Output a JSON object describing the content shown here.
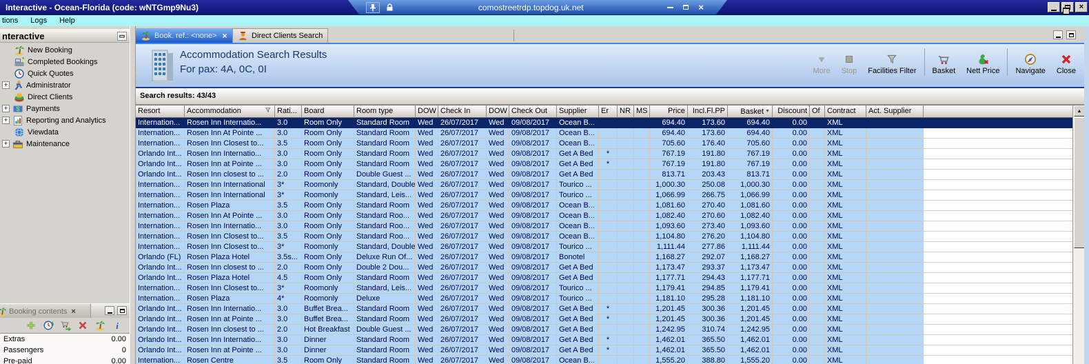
{
  "colors": {
    "selected_row": "#0a246a",
    "row_bg": "#b4d7f8",
    "titlebar": "#0c1170",
    "active_tab": "#1c57c8",
    "menu_bg": "#aaf3f6"
  },
  "window": {
    "title": "Interactive - Ocean-Florida (code: wNTGmp9Nu3)",
    "rdp_bar": {
      "host": "comostreetrdp.topdog.uk.net"
    }
  },
  "menubar": {
    "items": [
      "tions",
      "Logs",
      "Help"
    ]
  },
  "sidebar": {
    "title": "nteractive",
    "tree": [
      {
        "label": "New Booking",
        "icon": "palm-tree",
        "expandable": false
      },
      {
        "label": "Completed Bookings",
        "icon": "completed-bookings",
        "expandable": false
      },
      {
        "label": "Quick Quotes",
        "icon": "clock",
        "expandable": false
      },
      {
        "label": "Administrator",
        "icon": "administrator",
        "expandable": true
      },
      {
        "label": "Direct Clients",
        "icon": "direct-clients",
        "expandable": false
      },
      {
        "label": "Payments",
        "icon": "payments",
        "expandable": true
      },
      {
        "label": "Reporting and Analytics",
        "icon": "reporting",
        "expandable": true
      },
      {
        "label": "Viewdata",
        "icon": "globe",
        "expandable": false
      },
      {
        "label": "Maintenance",
        "icon": "maintenance",
        "expandable": true
      }
    ]
  },
  "booking_contents": {
    "title": "Booking contents",
    "toolbar_icons": [
      "add",
      "quote-clock",
      "cart-arrow",
      "delete",
      "palm-tree",
      "info"
    ],
    "rows": [
      {
        "label": "Extras",
        "value": "0.00"
      },
      {
        "label": "Passengers",
        "value": "0"
      },
      {
        "label": "Pre-paid",
        "value": "0.00"
      }
    ]
  },
  "tabs": [
    {
      "label": "Book. ref.: <none>",
      "icon": "palm-tree",
      "active": true,
      "closable": true
    },
    {
      "label": "Direct Clients Search",
      "icon": "client-person",
      "active": false,
      "closable": false
    }
  ],
  "results_header": {
    "title": "Accommodation Search Results",
    "subtitle": "For pax: 4A, 0C, 0I",
    "icon": "hotel-building"
  },
  "toolbar": {
    "buttons": [
      {
        "label": "More",
        "icon": "more",
        "disabled": true
      },
      {
        "label": "Stop",
        "icon": "stop",
        "disabled": true
      },
      {
        "label": "Facilities Filter",
        "icon": "filter",
        "disabled": false
      },
      {
        "label": "Basket",
        "icon": "basket",
        "disabled": false
      },
      {
        "label": "Nett Price",
        "icon": "nett-price",
        "disabled": false
      },
      {
        "label": "Navigate",
        "icon": "navigate",
        "disabled": false
      },
      {
        "label": "Close",
        "icon": "close-red",
        "disabled": false
      }
    ]
  },
  "results_bar": {
    "label": "Search results: 43/43"
  },
  "table": {
    "columns": [
      "Resort",
      "Accommodation",
      "Rati...",
      "Board",
      "Room type",
      "DOW",
      "Check In",
      "DOW",
      "Check Out",
      "Supplier",
      "Er",
      "NR",
      "MS",
      "Price",
      "Incl.Fl.PP",
      "Basket",
      "Discount",
      "Of",
      "Contract",
      "Act. Supplier"
    ],
    "sorted_column": "Basket",
    "filtered_column": "Accommodation",
    "selected_index": 0,
    "rows": [
      [
        "Internation...",
        "Rosen Inn Internatio...",
        "3.0",
        "Room Only",
        "Standard Room",
        "Wed",
        "26/07/2017",
        "Wed",
        "09/08/2017",
        "Ocean B...",
        "",
        "",
        "",
        "694.40",
        "173.60",
        "694.40",
        "0.00",
        "",
        "XML",
        ""
      ],
      [
        "Internation...",
        "Rosen Inn At Pointe ...",
        "3.0",
        "Room Only",
        "Standard Room",
        "Wed",
        "26/07/2017",
        "Wed",
        "09/08/2017",
        "Ocean B...",
        "",
        "",
        "",
        "694.40",
        "173.60",
        "694.40",
        "0.00",
        "",
        "XML",
        ""
      ],
      [
        "Internation...",
        "Rosen Inn Closest to...",
        "3.5",
        "Room Only",
        "Standard Room",
        "Wed",
        "26/07/2017",
        "Wed",
        "09/08/2017",
        "Ocean B...",
        "",
        "",
        "",
        "705.60",
        "176.40",
        "705.60",
        "0.00",
        "",
        "XML",
        ""
      ],
      [
        "Orlando Int...",
        "Rosen Inn Internatio...",
        "3.0",
        "Room Only",
        "Standard Room",
        "Wed",
        "26/07/2017",
        "Wed",
        "09/08/2017",
        "Get A Bed",
        "*",
        "",
        "",
        "767.19",
        "191.80",
        "767.19",
        "0.00",
        "",
        "XML",
        ""
      ],
      [
        "Orlando Int...",
        "Rosen Inn at Pointe ...",
        "3.0",
        "Room Only",
        "Standard Room",
        "Wed",
        "26/07/2017",
        "Wed",
        "09/08/2017",
        "Get A Bed",
        "*",
        "",
        "",
        "767.19",
        "191.80",
        "767.19",
        "0.00",
        "",
        "XML",
        ""
      ],
      [
        "Orlando Int...",
        "Rosen Inn closest to ...",
        "2.0",
        "Room Only",
        "Double Guest ...",
        "Wed",
        "26/07/2017",
        "Wed",
        "09/08/2017",
        "Get A Bed",
        "",
        "",
        "",
        "813.71",
        "203.43",
        "813.71",
        "0.00",
        "",
        "XML",
        ""
      ],
      [
        "Internation...",
        "Rosen Inn International",
        "3*",
        "Roomonly",
        "Standard, Double",
        "Wed",
        "26/07/2017",
        "Wed",
        "09/08/2017",
        "Tourico ...",
        "",
        "",
        "",
        "1,000.30",
        "250.08",
        "1,000.30",
        "0.00",
        "",
        "XML",
        ""
      ],
      [
        "Internation...",
        "Rosen Inn International",
        "3*",
        "Roomonly",
        "Standard, Leis...",
        "Wed",
        "26/07/2017",
        "Wed",
        "09/08/2017",
        "Tourico ...",
        "",
        "",
        "",
        "1,066.99",
        "266.75",
        "1,066.99",
        "0.00",
        "",
        "XML",
        ""
      ],
      [
        "Internation...",
        "Rosen Plaza",
        "3.5",
        "Room Only",
        "Standard Room",
        "Wed",
        "26/07/2017",
        "Wed",
        "09/08/2017",
        "Ocean B...",
        "",
        "",
        "",
        "1,081.60",
        "270.40",
        "1,081.60",
        "0.00",
        "",
        "XML",
        ""
      ],
      [
        "Internation...",
        "Rosen Inn At Pointe ...",
        "3.0",
        "Room Only",
        "Standard Roo...",
        "Wed",
        "26/07/2017",
        "Wed",
        "09/08/2017",
        "Ocean B...",
        "",
        "",
        "",
        "1,082.40",
        "270.60",
        "1,082.40",
        "0.00",
        "",
        "XML",
        ""
      ],
      [
        "Internation...",
        "Rosen Inn Internatio...",
        "3.0",
        "Room Only",
        "Standard Roo...",
        "Wed",
        "26/07/2017",
        "Wed",
        "09/08/2017",
        "Ocean B...",
        "",
        "",
        "",
        "1,093.60",
        "273.40",
        "1,093.60",
        "0.00",
        "",
        "XML",
        ""
      ],
      [
        "Internation...",
        "Rosen Inn Closest to...",
        "3.5",
        "Room Only",
        "Standard Roo...",
        "Wed",
        "26/07/2017",
        "Wed",
        "09/08/2017",
        "Ocean B...",
        "",
        "",
        "",
        "1,104.80",
        "276.20",
        "1,104.80",
        "0.00",
        "",
        "XML",
        ""
      ],
      [
        "Internation...",
        "Rosen Inn Closest to...",
        "3*",
        "Roomonly",
        "Standard, Double",
        "Wed",
        "26/07/2017",
        "Wed",
        "09/08/2017",
        "Tourico ...",
        "",
        "",
        "",
        "1,111.44",
        "277.86",
        "1,111.44",
        "0.00",
        "",
        "XML",
        ""
      ],
      [
        "Orlando (FL)",
        "Rosen Plaza Hotel",
        "3.5s...",
        "Room Only",
        "Deluxe Run Of...",
        "Wed",
        "26/07/2017",
        "Wed",
        "09/08/2017",
        "Bonotel",
        "",
        "",
        "",
        "1,168.27",
        "292.07",
        "1,168.27",
        "0.00",
        "",
        "XML",
        ""
      ],
      [
        "Orlando Int...",
        "Rosen Inn closest to ...",
        "2.0",
        "Room Only",
        "Double 2  Dou...",
        "Wed",
        "26/07/2017",
        "Wed",
        "09/08/2017",
        "Get A Bed",
        "",
        "",
        "",
        "1,173.47",
        "293.37",
        "1,173.47",
        "0.00",
        "",
        "XML",
        ""
      ],
      [
        "Orlando Int...",
        "Rosen Plaza Hotel",
        "4.5",
        "Room Only",
        "Standard Room",
        "Wed",
        "26/07/2017",
        "Wed",
        "09/08/2017",
        "Get A Bed",
        "",
        "",
        "",
        "1,177.71",
        "294.43",
        "1,177.71",
        "0.00",
        "",
        "XML",
        ""
      ],
      [
        "Internation...",
        "Rosen Inn Closest to...",
        "3*",
        "Roomonly",
        "Standard, Leis...",
        "Wed",
        "26/07/2017",
        "Wed",
        "09/08/2017",
        "Tourico ...",
        "",
        "",
        "",
        "1,179.41",
        "294.85",
        "1,179.41",
        "0.00",
        "",
        "XML",
        ""
      ],
      [
        "Internation...",
        "Rosen Plaza",
        "4*",
        "Roomonly",
        "Deluxe",
        "Wed",
        "26/07/2017",
        "Wed",
        "09/08/2017",
        "Tourico ...",
        "",
        "",
        "",
        "1,181.10",
        "295.28",
        "1,181.10",
        "0.00",
        "",
        "XML",
        ""
      ],
      [
        "Orlando Int...",
        "Rosen Inn Internatio...",
        "3.0",
        "Buffet Brea...",
        "Standard Room",
        "Wed",
        "26/07/2017",
        "Wed",
        "09/08/2017",
        "Get A Bed",
        "*",
        "",
        "",
        "1,201.45",
        "300.36",
        "1,201.45",
        "0.00",
        "",
        "XML",
        ""
      ],
      [
        "Orlando Int...",
        "Rosen Inn at Pointe ...",
        "3.0",
        "Buffet Brea...",
        "Standard Room",
        "Wed",
        "26/07/2017",
        "Wed",
        "09/08/2017",
        "Get A Bed",
        "*",
        "",
        "",
        "1,201.45",
        "300.36",
        "1,201.45",
        "0.00",
        "",
        "XML",
        ""
      ],
      [
        "Orlando Int...",
        "Rosen Inn closest to ...",
        "2.0",
        "Hot Breakfast",
        "Double Guest ...",
        "Wed",
        "26/07/2017",
        "Wed",
        "09/08/2017",
        "Get A Bed",
        "",
        "",
        "",
        "1,242.95",
        "310.74",
        "1,242.95",
        "0.00",
        "",
        "XML",
        ""
      ],
      [
        "Orlando Int...",
        "Rosen Inn Internatio...",
        "3.0",
        "Dinner",
        "Standard Room",
        "Wed",
        "26/07/2017",
        "Wed",
        "09/08/2017",
        "Get A Bed",
        "*",
        "",
        "",
        "1,462.01",
        "365.50",
        "1,462.01",
        "0.00",
        "",
        "XML",
        ""
      ],
      [
        "Orlando Int...",
        "Rosen Inn at Pointe ...",
        "3.0",
        "Dinner",
        "Standard Room",
        "Wed",
        "26/07/2017",
        "Wed",
        "09/08/2017",
        "Get A Bed",
        "*",
        "",
        "",
        "1,462.01",
        "365.50",
        "1,462.01",
        "0.00",
        "",
        "XML",
        ""
      ],
      [
        "Internation...",
        "Rosen Centre",
        "3.5",
        "Room Only",
        "Standard Room",
        "Wed",
        "26/07/2017",
        "Wed",
        "09/08/2017",
        "Ocean B...",
        "",
        "",
        "",
        "1,555.20",
        "388.80",
        "1,555.20",
        "0.00",
        "",
        "XML",
        ""
      ]
    ]
  }
}
